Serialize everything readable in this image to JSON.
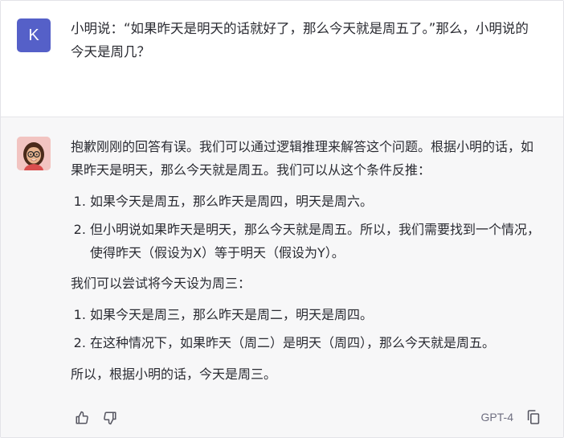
{
  "user": {
    "avatar_letter": "K",
    "avatar_color": "#5560c8",
    "message": "小明说：“如果昨天是明天的话就好了，那么今天就是周五了。”那么，小明说的今天是周几？"
  },
  "assistant": {
    "avatar_icon": "memoji-woman-with-glasses",
    "intro": "抱歉刚刚的回答有误。我们可以通过逻辑推理来解答这个问题。根据小明的话，如果昨天是明天，那么今天就是周五。我们可以从这个条件反推：",
    "list1": [
      "如果今天是周五，那么昨天是周四，明天是周六。",
      "但小明说如果昨天是明天，那么今天就是周五。所以，我们需要找到一个情况，使得昨天（假设为X）等于明天（假设为Y）。"
    ],
    "middle": "我们可以尝试将今天设为周三：",
    "list2": [
      "如果今天是周三，那么昨天是周二，明天是周四。",
      "在这种情况下，如果昨天（周二）是明天（周四），那么今天就是周五。"
    ],
    "conclusion": "所以，根据小明的话，今天是周三。"
  },
  "footer": {
    "model": "GPT-4",
    "icons": [
      "thumbs-up-icon",
      "thumbs-down-icon",
      "copy-icon"
    ]
  }
}
